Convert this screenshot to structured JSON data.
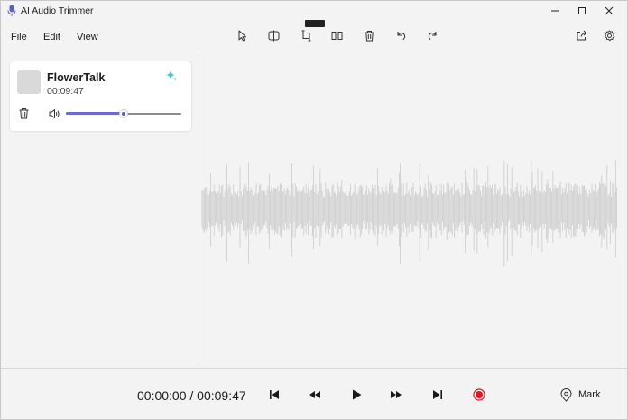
{
  "window": {
    "title": "AI Audio Trimmer",
    "app_icon": "microphone-icon",
    "controls": [
      "minimize-icon",
      "maximize-icon",
      "close-icon"
    ]
  },
  "menu": {
    "items": [
      {
        "label": "File"
      },
      {
        "label": "Edit"
      },
      {
        "label": "View"
      }
    ]
  },
  "toolbar": {
    "tools": [
      {
        "icon": "select-pointer-icon"
      },
      {
        "icon": "split-icon"
      },
      {
        "icon": "trim-icon"
      },
      {
        "icon": "cut-section-icon"
      },
      {
        "icon": "delete-icon"
      },
      {
        "icon": "undo-icon"
      },
      {
        "icon": "redo-icon"
      }
    ],
    "right_tools": [
      {
        "icon": "share-icon"
      },
      {
        "icon": "settings-gear-icon"
      }
    ]
  },
  "track": {
    "name": "FlowerTalk",
    "duration": "00:09:47",
    "volume_percent": 50,
    "icons": [
      "sparkle-icon",
      "trash-icon",
      "volume-icon"
    ]
  },
  "transport": {
    "timecode": "00:00:00 / 00:09:47",
    "buttons": [
      "skip-to-start-icon",
      "rewind-icon",
      "play-icon",
      "fast-forward-icon",
      "skip-to-end-icon",
      "record-icon"
    ],
    "mark_label": "Mark",
    "mark_icon": "location-pin-icon"
  },
  "colors": {
    "accent": "#6b6bd1",
    "record": "#e81123",
    "sparkle": "#4cc3d9",
    "waveform": "#cfcfcf",
    "background": "#f3f3f3"
  }
}
